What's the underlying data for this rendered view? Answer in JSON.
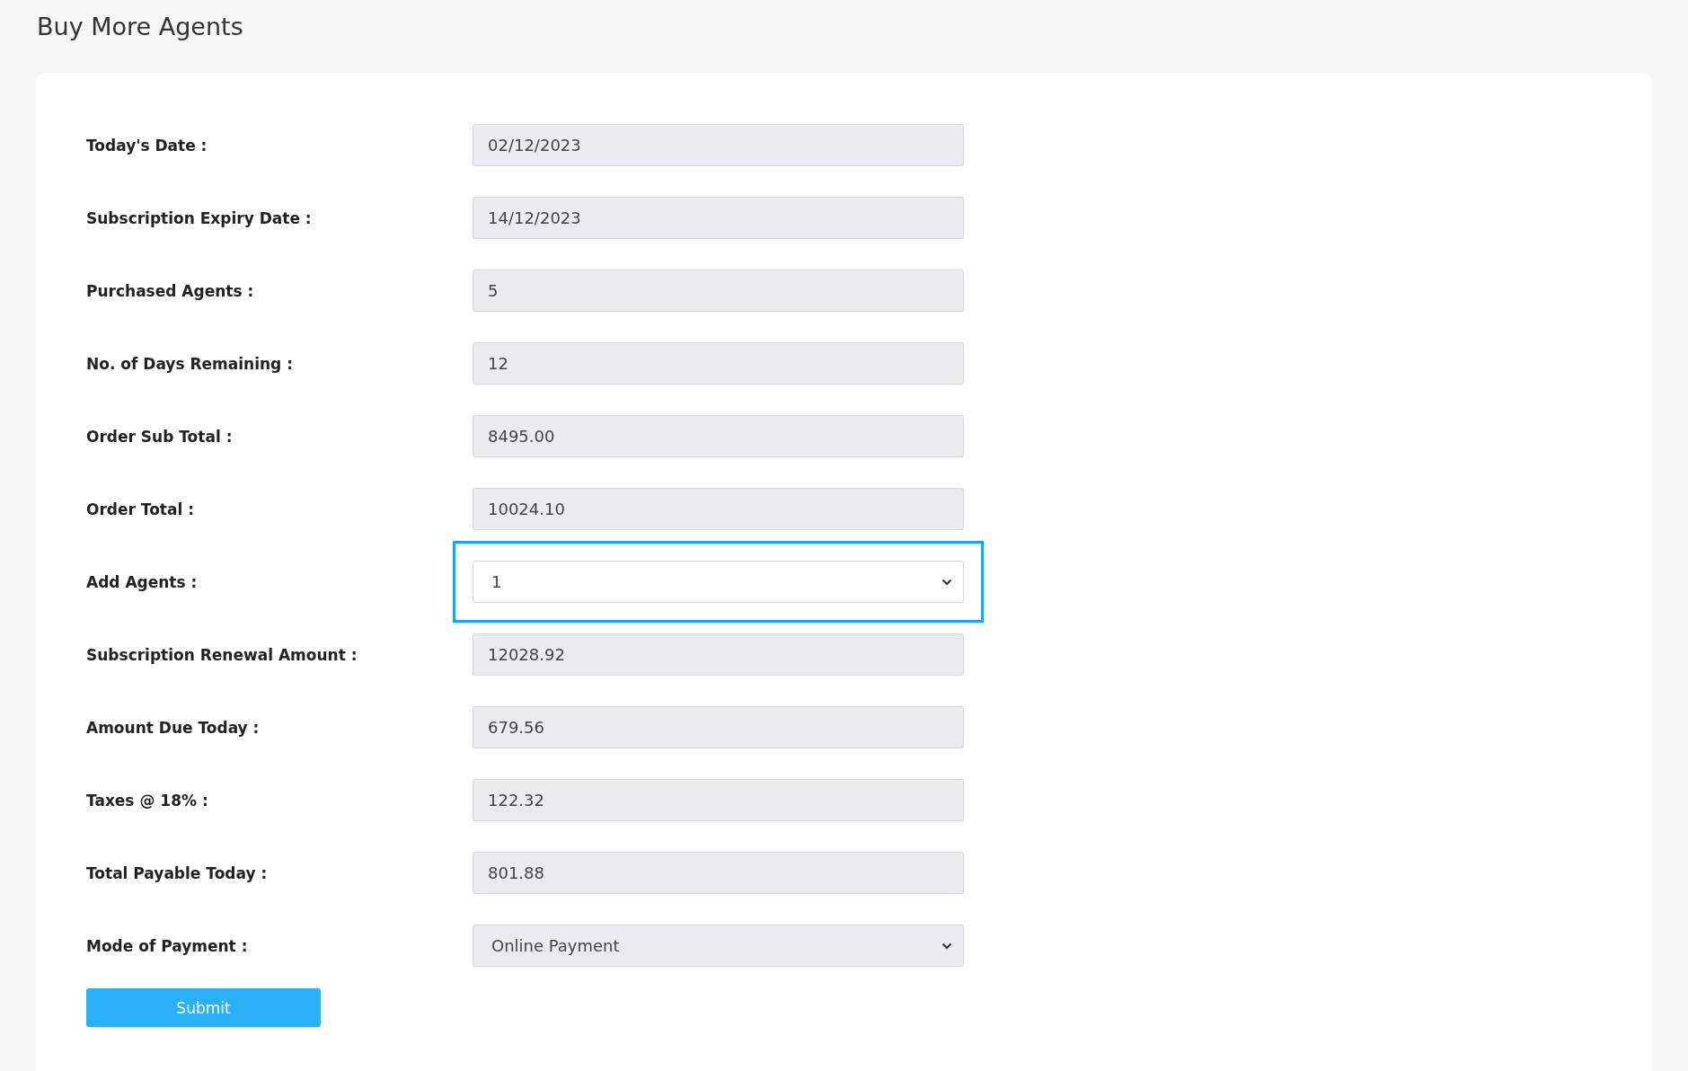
{
  "page_title": "Buy More Agents",
  "fields": [
    {
      "label": "Today's Date :",
      "kind": "text",
      "value": "02/12/2023",
      "disabled": true,
      "highlighted": false
    },
    {
      "label": "Subscription Expiry Date :",
      "kind": "text",
      "value": "14/12/2023",
      "disabled": true,
      "highlighted": false
    },
    {
      "label": "Purchased Agents :",
      "kind": "text",
      "value": "5",
      "disabled": true,
      "highlighted": false
    },
    {
      "label": "No. of Days Remaining :",
      "kind": "text",
      "value": "12",
      "disabled": true,
      "highlighted": false
    },
    {
      "label": "Order Sub Total :",
      "kind": "text",
      "value": "8495.00",
      "disabled": true,
      "highlighted": false
    },
    {
      "label": "Order Total :",
      "kind": "text",
      "value": "10024.10",
      "disabled": true,
      "highlighted": false
    },
    {
      "label": "Add Agents :",
      "kind": "select",
      "value": "1",
      "disabled": false,
      "highlighted": true
    },
    {
      "label": "Subscription Renewal Amount :",
      "kind": "text",
      "value": "12028.92",
      "disabled": true,
      "highlighted": false
    },
    {
      "label": "Amount Due Today :",
      "kind": "text",
      "value": "679.56",
      "disabled": true,
      "highlighted": false
    },
    {
      "label": "Taxes @ 18% :",
      "kind": "text",
      "value": "122.32",
      "disabled": true,
      "highlighted": false
    },
    {
      "label": "Total Payable Today :",
      "kind": "text",
      "value": "801.88",
      "disabled": true,
      "highlighted": false
    },
    {
      "label": "Mode of Payment :",
      "kind": "select",
      "value": "Online Payment",
      "disabled": true,
      "highlighted": false
    }
  ],
  "submit_button": "Submit"
}
